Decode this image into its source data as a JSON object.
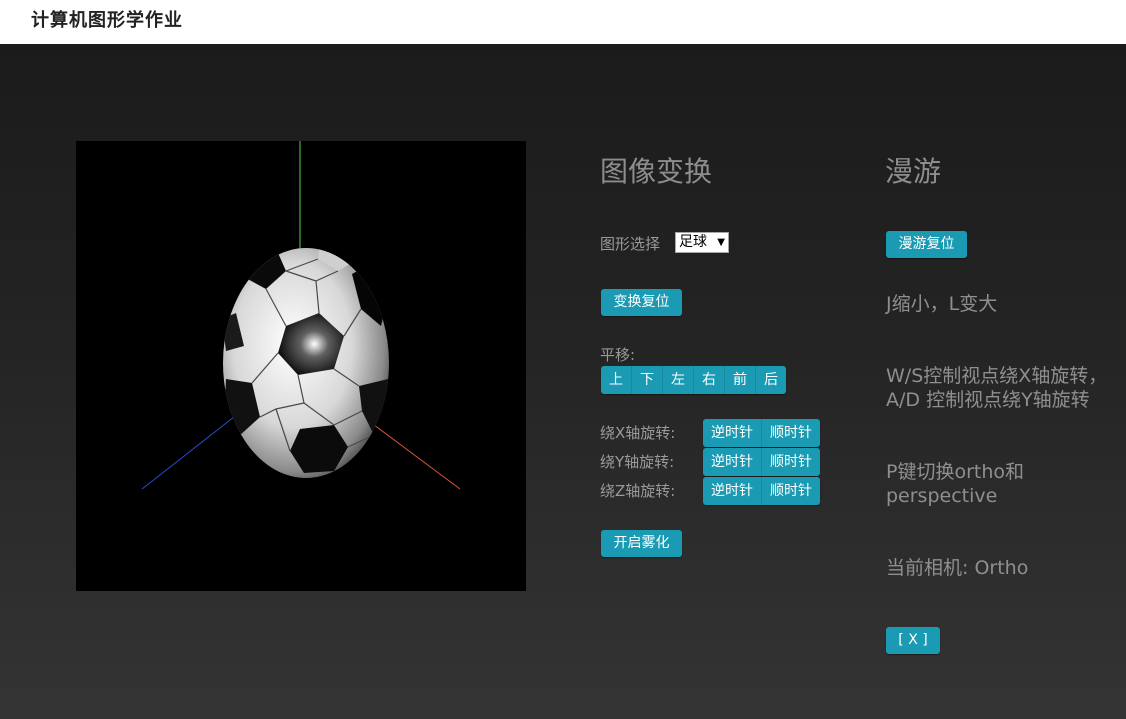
{
  "app": {
    "title": "计算机图形学作业"
  },
  "canvas": {
    "axis_colors": {
      "x": "#d4553a",
      "y": "#4fd44a",
      "z": "#2a4fd0"
    },
    "object": "soccer-ball"
  },
  "transform_panel": {
    "title": "图像变换",
    "shape_label": "图形选择",
    "shape_selected": "足球",
    "reset_label": "变换复位",
    "translate_label": "平移:",
    "translate_buttons": [
      "上",
      "下",
      "左",
      "右",
      "前",
      "后"
    ],
    "rot_x_label": "绕X轴旋转:",
    "rot_y_label": "绕Y轴旋转:",
    "rot_z_label": "绕Z轴旋转:",
    "ccw_label": "逆时针",
    "cw_label": "顺时针",
    "fog_label": "开启雾化"
  },
  "roam_panel": {
    "title": "漫游",
    "reset_label": "漫游复位",
    "zoom_hint": "J缩小，L变大",
    "ws_hint": "W/S控制视点绕X轴旋转，",
    "ad_hint": "A/D 控制视点绕Y轴旋转",
    "proj_hint_1": "P键切换ortho和",
    "proj_hint_2": "perspective",
    "camera_status": "当前相机: Ortho",
    "close_label": "[ X ]"
  },
  "colors": {
    "accent": "#1b9bb3",
    "panel_text": "#8f8f8f"
  }
}
